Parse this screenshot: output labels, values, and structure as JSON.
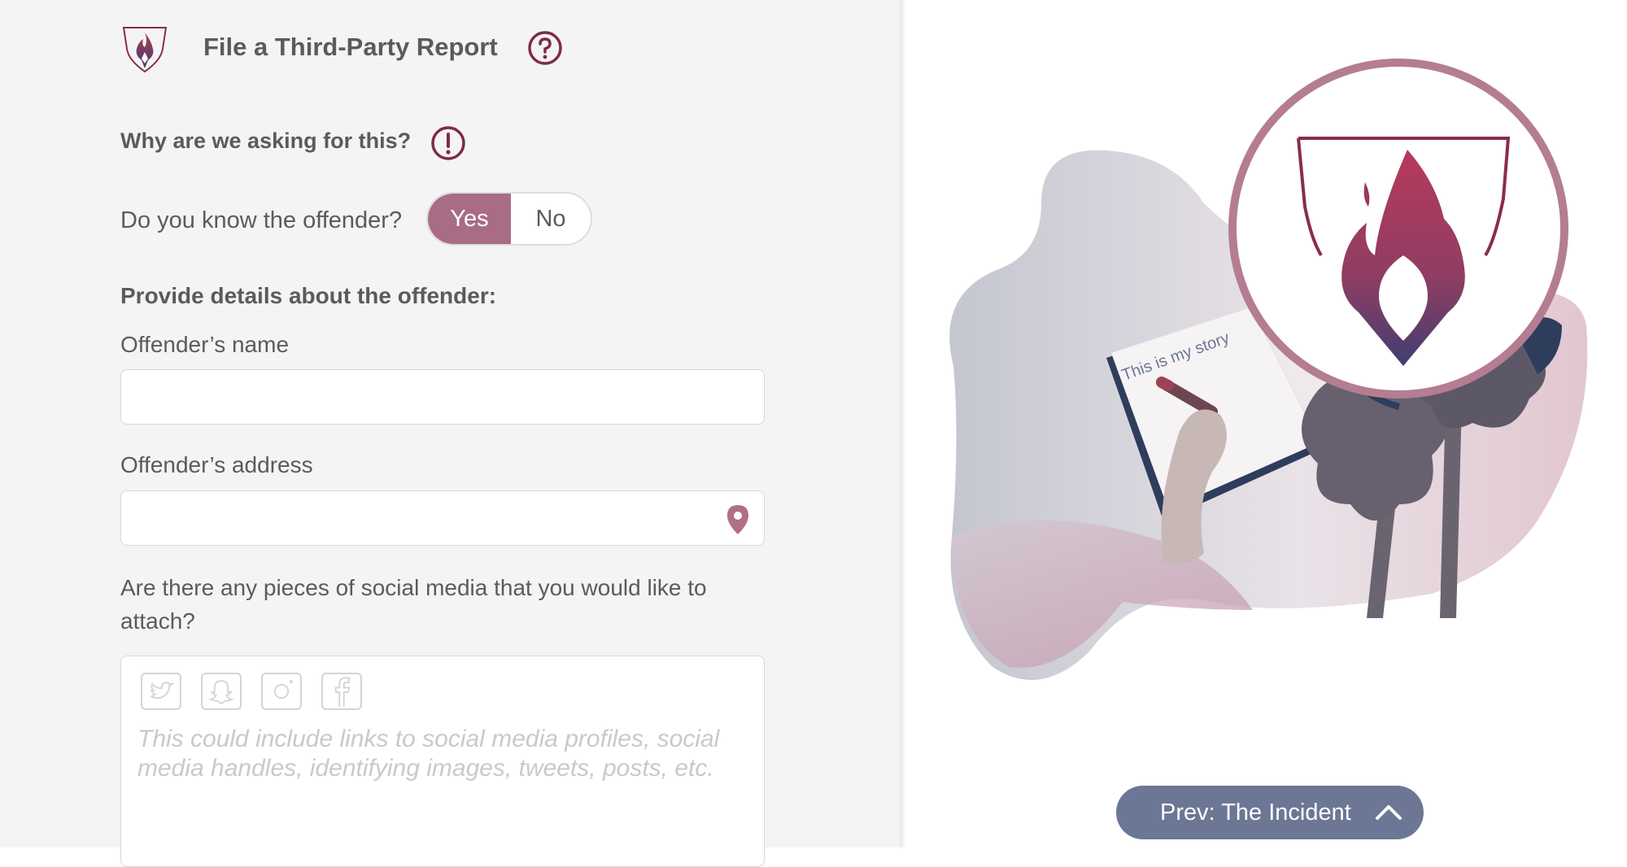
{
  "header": {
    "title": "File a Third-Party Report"
  },
  "why": {
    "text": "Why are we asking for this?"
  },
  "offender_known": {
    "question": "Do you know the offender?",
    "options": [
      "Yes",
      "No"
    ],
    "selected": "Yes"
  },
  "details": {
    "heading": "Provide details about the offender:",
    "name_label": "Offender’s name",
    "name_value": "",
    "address_label": "Offender’s address",
    "address_value": ""
  },
  "social": {
    "question": "Are there any pieces of social media that you would like to attach?",
    "icons": [
      "twitter-icon",
      "snapchat-icon",
      "instagram-icon",
      "facebook-icon"
    ],
    "placeholder": "This could include links to social media profiles, social media handles, identifying images, tweets, posts, etc."
  },
  "illustration": {
    "notebook_text": "This is my story"
  },
  "navigation": {
    "prev_label": "Prev: The Incident"
  },
  "colors": {
    "accent": "#a86d85",
    "brand_dark": "#7e2b48",
    "nav_button": "#6c7795",
    "text": "#5b5b5b",
    "panel": "#f4f4f4"
  }
}
